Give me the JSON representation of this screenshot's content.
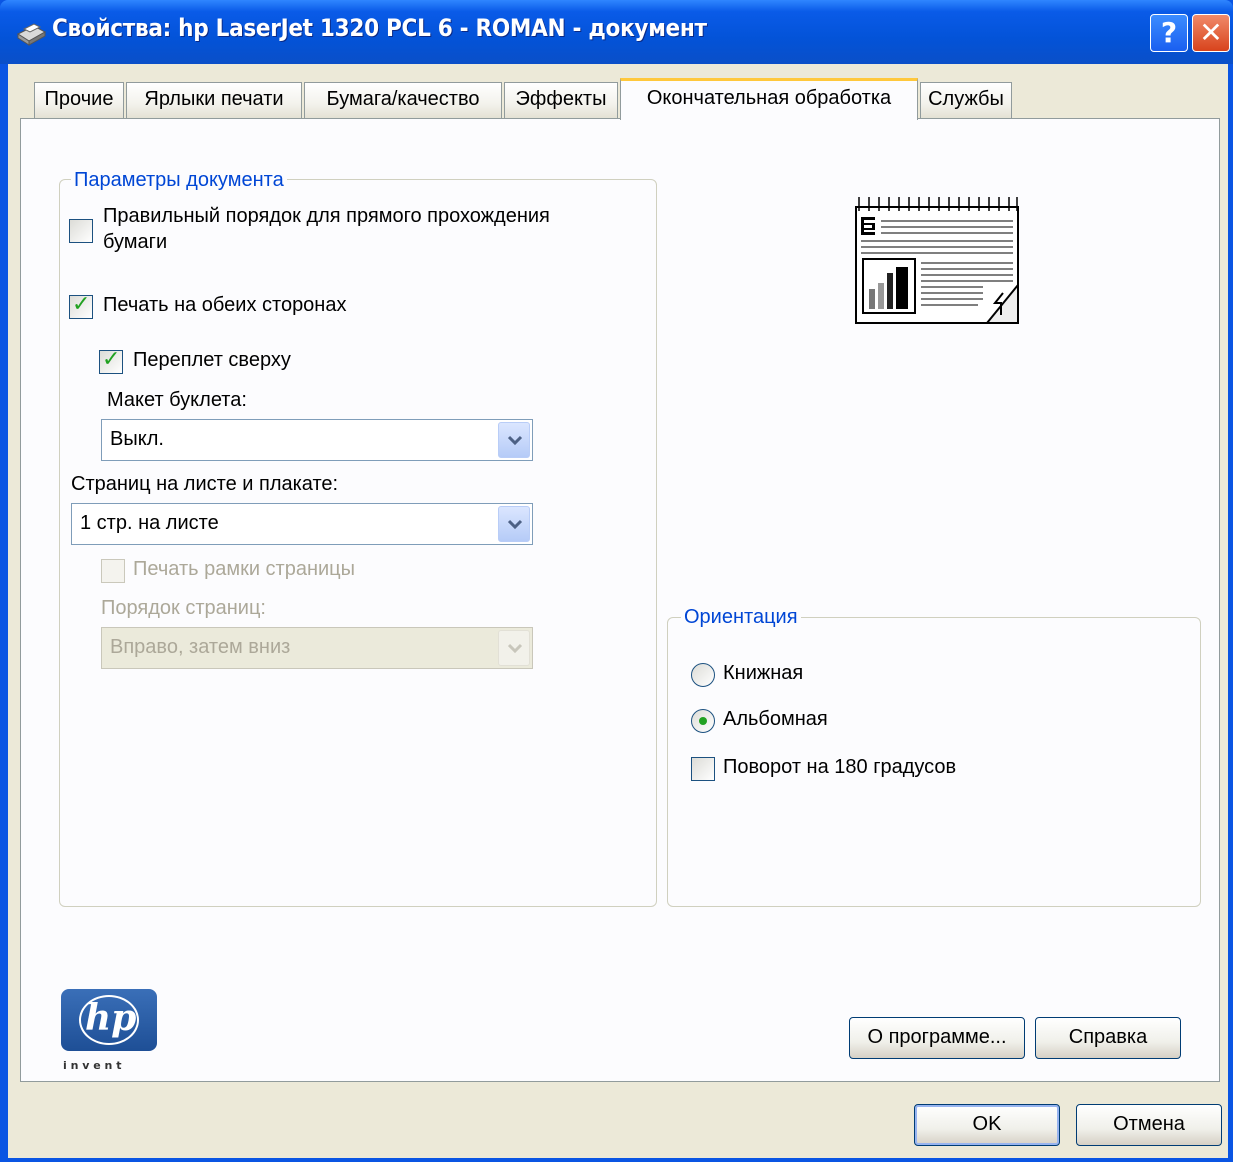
{
  "window": {
    "title": "Свойства: hp LaserJet 1320 PCL 6 - ROMAN - документ",
    "help_glyph": "?",
    "close_glyph": "✕"
  },
  "tabs": [
    {
      "label": "Прочие",
      "active": false
    },
    {
      "label": "Ярлыки печати",
      "active": false
    },
    {
      "label": "Бумага/качество",
      "active": false
    },
    {
      "label": "Эффекты",
      "active": false
    },
    {
      "label": "Окончательная обработка",
      "active": true
    },
    {
      "label": "Службы",
      "active": false
    }
  ],
  "document_options": {
    "legend": "Параметры документа",
    "straight_paper_path": {
      "label_line1": "Правильный порядок для прямого прохождения",
      "label_line2": "бумаги",
      "checked": false
    },
    "print_both_sides": {
      "label": "Печать на обеих сторонах",
      "checked": true
    },
    "flip_up": {
      "label": "Переплет сверху",
      "checked": true
    },
    "booklet_label": "Макет буклета:",
    "booklet_value": "Выкл.",
    "pages_per_sheet_label": "Страниц на листе и плакате:",
    "pages_per_sheet_value": "1 стр. на листе",
    "print_page_borders": {
      "label": "Печать рамки страницы",
      "checked": false,
      "enabled": false
    },
    "page_order_label": "Порядок страниц:",
    "page_order_value": "Вправо, затем вниз"
  },
  "orientation": {
    "legend": "Ориентация",
    "portrait": {
      "label": "Книжная",
      "selected": false
    },
    "landscape": {
      "label": "Альбомная",
      "selected": true
    },
    "rotate_180": {
      "label": "Поворот на 180 градусов",
      "checked": false
    }
  },
  "logo": {
    "brand": "hp",
    "tagline": "i n v e n t"
  },
  "buttons": {
    "about": "О программе...",
    "help": "Справка",
    "ok": "OK",
    "cancel": "Отмена"
  },
  "colors": {
    "titlebar": "#0a5be8",
    "dialog_bg": "#ece9d8",
    "panel_bg": "#fcfcfe",
    "group_legend": "#0046d5",
    "checkmark": "#21a121",
    "disabled_text": "#aca899"
  }
}
